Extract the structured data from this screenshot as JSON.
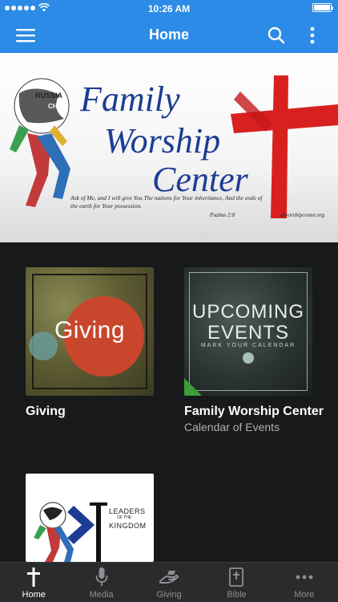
{
  "status_bar": {
    "time": "10:26 AM"
  },
  "nav": {
    "title": "Home"
  },
  "banner": {
    "title_line1": "Family",
    "title_line2": "Worship",
    "title_line3": "Center",
    "globe_words": [
      "RUSSIA",
      "CHINA"
    ],
    "verse": "Ask of Me, and I will give You The nations for Your inheritance, And the ends of the earth for Your possession.",
    "reference": "Psalms 2:8",
    "url": "sfworshipcenter.org"
  },
  "tiles": [
    {
      "image_text": "Giving",
      "title": "Giving",
      "subtitle": ""
    },
    {
      "image_line1": "UPCOMING",
      "image_line2": "EVENTS",
      "image_sub": "MARK YOUR CALENDAR",
      "title": "Family Worship Center",
      "subtitle": "Calendar of Events"
    },
    {
      "image_line1": "LEADERS",
      "image_line2": "OF THE",
      "image_line3": "KINGDOM"
    }
  ],
  "tab_bar": {
    "items": [
      {
        "label": "Home",
        "icon": "cross-icon",
        "active": true
      },
      {
        "label": "Media",
        "icon": "microphone-icon",
        "active": false
      },
      {
        "label": "Giving",
        "icon": "giving-hand-icon",
        "active": false
      },
      {
        "label": "Bible",
        "icon": "bible-icon",
        "active": false
      },
      {
        "label": "More",
        "icon": "more-dots-icon",
        "active": false
      }
    ]
  },
  "colors": {
    "nav_blue": "#2c8be6",
    "background": "#18191b",
    "banner_blue": "#1c3d93",
    "banner_red": "#d8201f"
  }
}
